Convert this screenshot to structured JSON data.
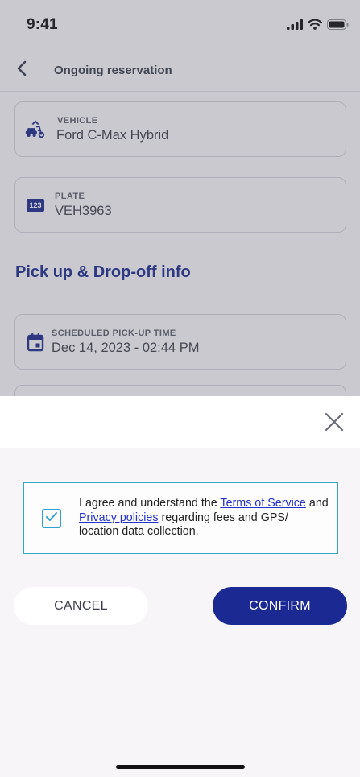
{
  "status_bar": {
    "time": "9:41",
    "icons": [
      "cellular-icon",
      "wifi-icon",
      "battery-icon"
    ]
  },
  "nav": {
    "title": "Ongoing reservation",
    "back_icon": "chevron-left-icon"
  },
  "details": {
    "vehicle": {
      "label": "VEHICLE",
      "value": "Ford C-Max Hybrid",
      "icon": "vehicle-icon"
    },
    "plate": {
      "label": "PLATE",
      "value": "VEH3963",
      "icon": "plate-123-icon",
      "icon_text": "123"
    },
    "section_title": "Pick up & Drop-off info",
    "pickup": {
      "label": "SCHEDULED PICK-UP TIME",
      "value": "Dec 14, 2023 - 02:44 PM",
      "icon": "calendar-icon"
    }
  },
  "modal": {
    "close_icon": "close-icon",
    "consent": {
      "checked": true,
      "text_1": "I agree and understand the ",
      "terms_link": "Terms of Service",
      "text_2": " and ",
      "privacy_link": "Privacy policies",
      "text_3": " regarding fees and GPS/ location data collection."
    },
    "cancel_label": "CANCEL",
    "confirm_label": "CONFIRM"
  },
  "colors": {
    "brand_navy": "#1b2993",
    "link": "#2431c9",
    "checkbox": "#2f9fd6",
    "consent_border": "#35a8c8"
  }
}
